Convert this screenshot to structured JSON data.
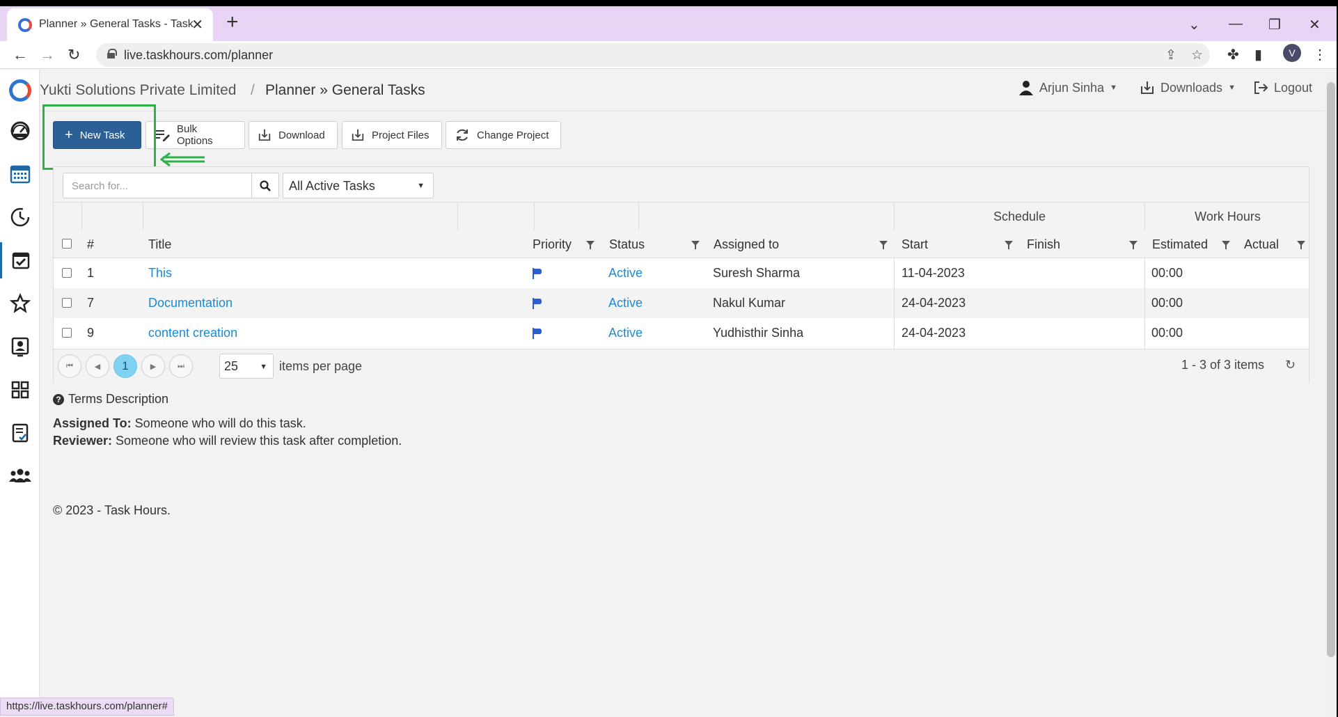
{
  "browser": {
    "tab_title": "Planner » General Tasks - Task Hours",
    "url": "live.taskhours.com/planner",
    "profile_initial": "V",
    "status_url": "https://live.taskhours.com/planner#"
  },
  "header": {
    "org": "Yukti Solutions Private Limited",
    "separator": "/",
    "page_title": "Planner » General Tasks",
    "user": "Arjun Sinha",
    "downloads": "Downloads",
    "logout": "Logout"
  },
  "toolbar": {
    "new_task": "New Task",
    "bulk_options": "Bulk Options",
    "download": "Download",
    "project_files": "Project Files",
    "change_project": "Change Project"
  },
  "grid": {
    "search_placeholder": "Search for...",
    "filter_selected": "All Active Tasks",
    "groups": {
      "schedule": "Schedule",
      "work_hours": "Work Hours"
    },
    "columns": {
      "num": "#",
      "title": "Title",
      "priority": "Priority",
      "status": "Status",
      "assigned": "Assigned to",
      "start": "Start",
      "finish": "Finish",
      "estimated": "Estimated",
      "actual": "Actual"
    },
    "rows": [
      {
        "num": "1",
        "title": "This",
        "status": "Active",
        "assigned": "Suresh Sharma",
        "start": "11-04-2023",
        "finish": "",
        "estimated": "00:00",
        "actual": ""
      },
      {
        "num": "7",
        "title": "Documentation",
        "status": "Active",
        "assigned": "Nakul Kumar",
        "start": "24-04-2023",
        "finish": "",
        "estimated": "00:00",
        "actual": ""
      },
      {
        "num": "9",
        "title": "content creation",
        "status": "Active",
        "assigned": "Yudhisthir Sinha",
        "start": "24-04-2023",
        "finish": "",
        "estimated": "00:00",
        "actual": ""
      }
    ],
    "pager": {
      "current_page": "1",
      "page_size": "25",
      "items_per_page": "items per page",
      "summary": "1 - 3 of 3 items"
    }
  },
  "terms": {
    "title": "Terms Description",
    "assigned_label": "Assigned To:",
    "assigned_text": " Someone who will do this task.",
    "reviewer_label": "Reviewer:",
    "reviewer_text": " Someone who will review this task after completion."
  },
  "footer": {
    "copyright": "© 2023 - Task Hours."
  },
  "colors": {
    "primary": "#2b5f96",
    "link": "#1a8ad4",
    "highlight": "#2fb14a",
    "flag": "#2b5fcf"
  }
}
